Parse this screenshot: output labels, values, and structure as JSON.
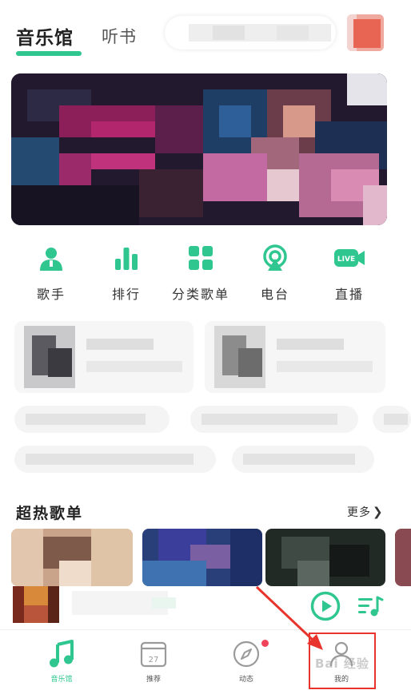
{
  "header": {
    "tabs": [
      {
        "label": "音乐馆",
        "active": true
      },
      {
        "label": "听书",
        "active": false
      }
    ],
    "search": {
      "placeholder": ""
    },
    "accent_color": "#2fc78f"
  },
  "quick_entries": [
    {
      "label": "歌手",
      "icon": "singer-icon"
    },
    {
      "label": "排行",
      "icon": "ranking-icon"
    },
    {
      "label": "分类歌单",
      "icon": "category-playlist-icon"
    },
    {
      "label": "电台",
      "icon": "radio-icon"
    },
    {
      "label": "直播",
      "icon": "live-icon",
      "badge": "LIVE"
    }
  ],
  "hot_playlists": {
    "title": "超热歌单",
    "more_label": "更多"
  },
  "bottom_nav": [
    {
      "label": "音乐馆",
      "icon": "music-note-icon",
      "active": true
    },
    {
      "label": "推荐",
      "icon": "calendar-icon",
      "active": false,
      "icon_text": "27"
    },
    {
      "label": "动态",
      "icon": "compass-icon",
      "active": false,
      "has_dot": true
    },
    {
      "label": "我的",
      "icon": "profile-icon",
      "active": false
    }
  ],
  "watermark": "Bai 经验",
  "colors": {
    "accent": "#2fc78f",
    "highlight": "#e8342c",
    "notification_dot": "#f0445a"
  }
}
